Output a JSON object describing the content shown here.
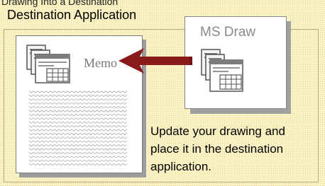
{
  "header": {
    "partial_text": "Drawing Into a Destination",
    "title": "Destination Application"
  },
  "memo": {
    "label": "Memo"
  },
  "source": {
    "label": "MS Draw"
  },
  "caption": {
    "line1": "Update your drawing and",
    "line2": "place it in the destination",
    "line3": "application."
  },
  "icons": {
    "memo": "document-table-icon",
    "source": "document-table-icon",
    "arrow": "left-arrow-icon"
  },
  "colors": {
    "background": "#fbf2c4",
    "arrow": "#8b1a1a",
    "memo_label": "#7b7b7b",
    "source_label": "#8a8a8a"
  }
}
